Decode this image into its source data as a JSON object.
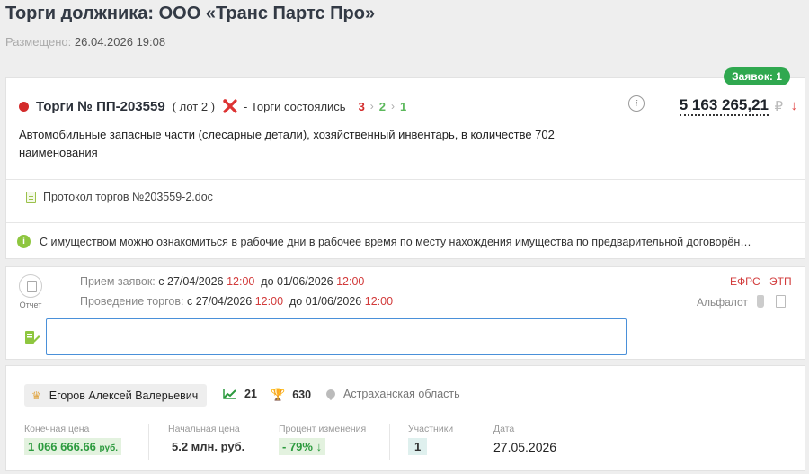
{
  "header": {
    "title": "Торги должника: ООО «Транс Партс Про»",
    "posted_label": "Размещено:",
    "posted_value": "26.04.2026 19:08"
  },
  "lot": {
    "bids_badge": "Заявок:  1",
    "number": "Торги № ПП-203559",
    "lot_suffix": "( лот 2 )",
    "status": "- Торги состоялись",
    "stages": [
      "3",
      "2",
      "1"
    ],
    "stage_colors": [
      "#d32b2b",
      "#5cb85c",
      "#5cb85c"
    ],
    "price": "5 163 265,21",
    "currency": "₽",
    "trend_icon": "arrow-down-icon",
    "description": "Автомобильные запасные части (слесарные детали), хозяйственный инвентарь, в количестве 702 наименования",
    "document": "Протокол торгов №203559-2.doc",
    "notice": "С имуществом можно ознакомиться в рабочие дни в рабочее время по месту нахождения имущества по предварительной договорён…"
  },
  "schedule": {
    "report_label": "Отчет",
    "applications_label": "Прием заявок:",
    "applications_from_prefix": "с",
    "applications_from_date": "27/04/2026",
    "applications_from_time": "12:00",
    "applications_to_prefix": "до",
    "applications_to_date": "01/06/2026",
    "applications_to_time": "12:00",
    "auction_label": "Проведение торгов:",
    "auction_from_prefix": "с",
    "auction_from_date": "27/04/2026",
    "auction_from_time": "12:00",
    "auction_to_prefix": "до",
    "auction_to_date": "01/06/2026",
    "auction_to_time": "12:00",
    "efrs": "ЕФРС",
    "etp": "ЭТП",
    "platform": "Альфалот",
    "note_value": ""
  },
  "result": {
    "winner": "Егоров Алексей Валерьевич",
    "stat_count": "21",
    "trophy_count": "630",
    "region": "Астраханская область",
    "final_price_label": "Конечная цена",
    "final_price_value": "1 066 666.66",
    "final_price_unit": "руб.",
    "start_price_label": "Начальная цена",
    "start_price_value": "5.2 млн. руб.",
    "change_label": "Процент изменения",
    "change_value": "- 79%",
    "participants_label": "Участники",
    "participants_value": "1",
    "date_label": "Дата",
    "date_value": "27.05.2026"
  },
  "colors": {
    "accent_red": "#d32b2b",
    "accent_green": "#2fa84f",
    "input_border": "#4a90d9"
  }
}
